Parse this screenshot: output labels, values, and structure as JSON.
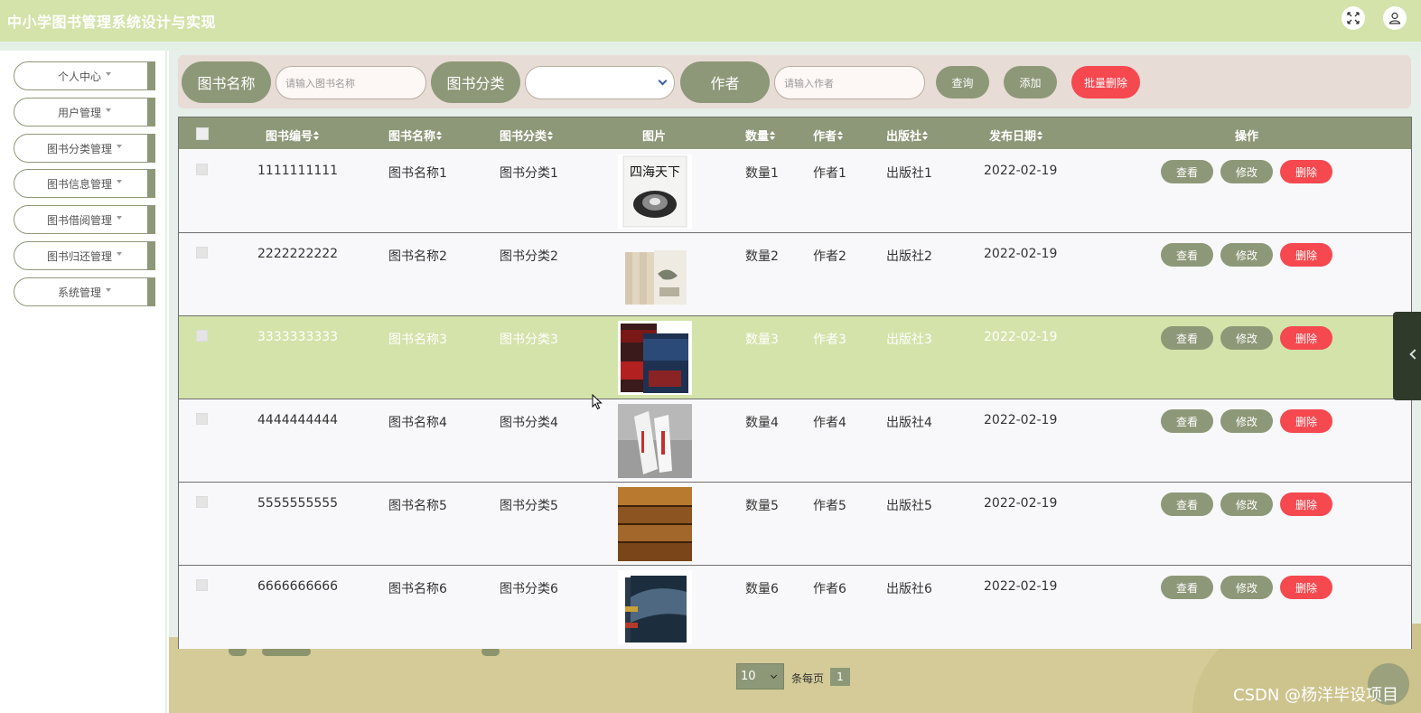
{
  "app": {
    "title": "中小学图书管理系统设计与实现",
    "icons": {
      "fullscreen": "fullscreen-icon",
      "user": "user-icon"
    }
  },
  "sidebar": {
    "items": [
      {
        "label": "个人中心"
      },
      {
        "label": "用户管理"
      },
      {
        "label": "图书分类管理"
      },
      {
        "label": "图书信息管理"
      },
      {
        "label": "图书借阅管理"
      },
      {
        "label": "图书归还管理"
      },
      {
        "label": "系统管理"
      }
    ]
  },
  "search": {
    "name_label": "图书名称",
    "name_placeholder": "请输入图书名称",
    "category_label": "图书分类",
    "category_value": "",
    "author_label": "作者",
    "author_placeholder": "请输入作者",
    "query_btn": "查询",
    "add_btn": "添加",
    "batch_delete_btn": "批量删除"
  },
  "table": {
    "headers": {
      "code": "图书编号",
      "name": "图书名称",
      "category": "图书分类",
      "image": "图片",
      "quantity": "数量",
      "author": "作者",
      "publisher": "出版社",
      "date": "发布日期",
      "actions": "操作"
    },
    "action_labels": {
      "view": "查看",
      "edit": "修改",
      "delete": "删除"
    },
    "rows": [
      {
        "code": "1111111111",
        "name": "图书名称1",
        "category": "图书分类1",
        "quantity": "数量1",
        "author": "作者1",
        "publisher": "出版社1",
        "date": "2022-02-19",
        "cover_text": "四海天下"
      },
      {
        "code": "2222222222",
        "name": "图书名称2",
        "category": "图书分类2",
        "quantity": "数量2",
        "author": "作者2",
        "publisher": "出版社2",
        "date": "2022-02-19"
      },
      {
        "code": "3333333333",
        "name": "图书名称3",
        "category": "图书分类3",
        "quantity": "数量3",
        "author": "作者3",
        "publisher": "出版社3",
        "date": "2022-02-19"
      },
      {
        "code": "4444444444",
        "name": "图书名称4",
        "category": "图书分类4",
        "quantity": "数量4",
        "author": "作者4",
        "publisher": "出版社4",
        "date": "2022-02-19"
      },
      {
        "code": "5555555555",
        "name": "图书名称5",
        "category": "图书分类5",
        "quantity": "数量5",
        "author": "作者5",
        "publisher": "出版社5",
        "date": "2022-02-19"
      },
      {
        "code": "6666666666",
        "name": "图书名称6",
        "category": "图书分类6",
        "quantity": "数量6",
        "author": "作者6",
        "publisher": "出版社6",
        "date": "2022-02-19"
      }
    ]
  },
  "pagination": {
    "page_size": "10",
    "per_page_text": "条每页",
    "current_page": "1"
  },
  "watermark": "CSDN @杨洋毕设项目",
  "colors": {
    "accent": "#8d9878",
    "header": "#d3e3aa",
    "danger": "#f5484f",
    "highlight_row": "#d3e3aa"
  }
}
